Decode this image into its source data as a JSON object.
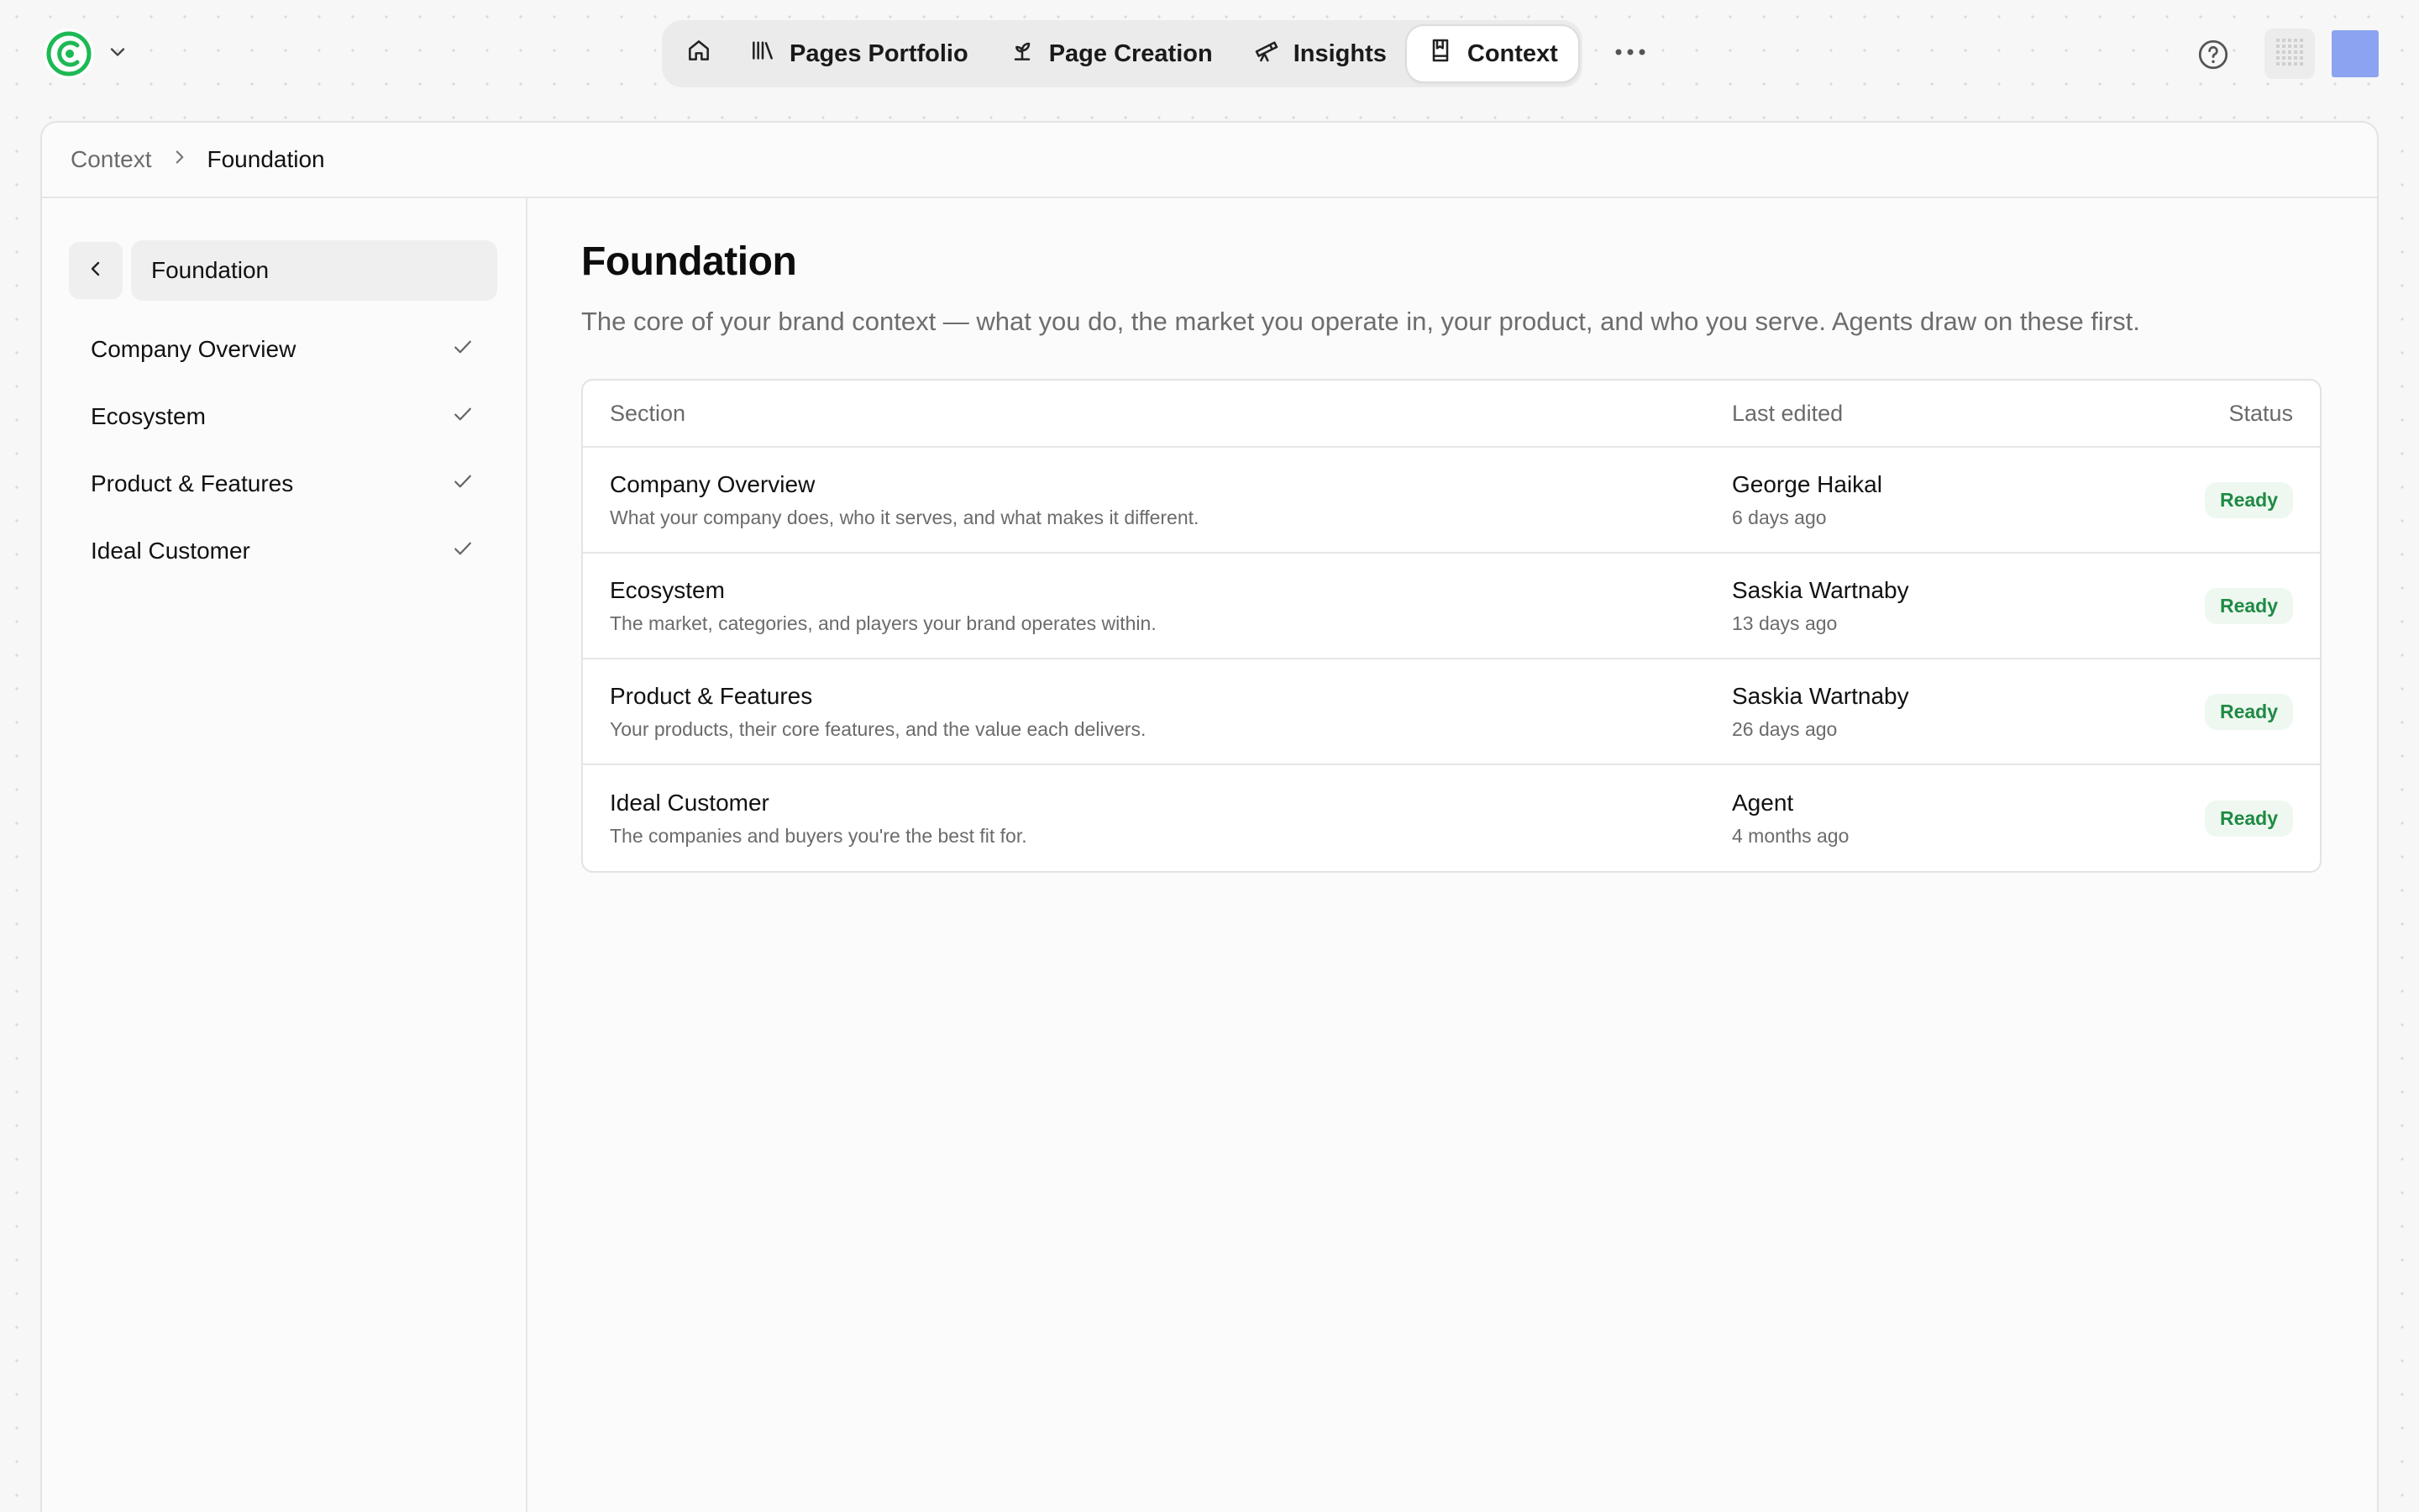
{
  "nav": {
    "items": [
      {
        "label": "Pages Portfolio",
        "icon": "library-icon"
      },
      {
        "label": "Page Creation",
        "icon": "plant-icon"
      },
      {
        "label": "Insights",
        "icon": "telescope-icon"
      },
      {
        "label": "Context",
        "icon": "book-icon",
        "active": true
      }
    ]
  },
  "breadcrumb": {
    "parent": "Context",
    "current": "Foundation"
  },
  "sidebar": {
    "title": "Foundation",
    "items": [
      {
        "label": "Company Overview",
        "done": true
      },
      {
        "label": "Ecosystem",
        "done": true
      },
      {
        "label": "Product & Features",
        "done": true
      },
      {
        "label": "Ideal Customer",
        "done": true
      }
    ]
  },
  "main": {
    "title": "Foundation",
    "description": "The core of your brand context — what you do, the market you operate in, your product, and who you serve. Agents draw on these first."
  },
  "table": {
    "headers": {
      "section": "Section",
      "last_edited": "Last edited",
      "status": "Status"
    },
    "rows": [
      {
        "name": "Company Overview",
        "description": "What your company does, who it serves, and what makes it different.",
        "editor": "George Haikal",
        "when": "6 days ago",
        "status": "Ready"
      },
      {
        "name": "Ecosystem",
        "description": "The market, categories, and players your brand operates within.",
        "editor": "Saskia Wartnaby",
        "when": "13 days ago",
        "status": "Ready"
      },
      {
        "name": "Product & Features",
        "description": "Your products, their core features, and the value each delivers.",
        "editor": "Saskia Wartnaby",
        "when": "26 days ago",
        "status": "Ready"
      },
      {
        "name": "Ideal Customer",
        "description": "The companies and buyers you're the best fit for.",
        "editor": "Agent",
        "when": "4 months ago",
        "status": "Ready"
      }
    ]
  },
  "colors": {
    "brand": "#1db954",
    "status_ready_text": "#1f8a44",
    "status_ready_bg": "#eef8f0",
    "avatar": "#8ba3f1"
  }
}
